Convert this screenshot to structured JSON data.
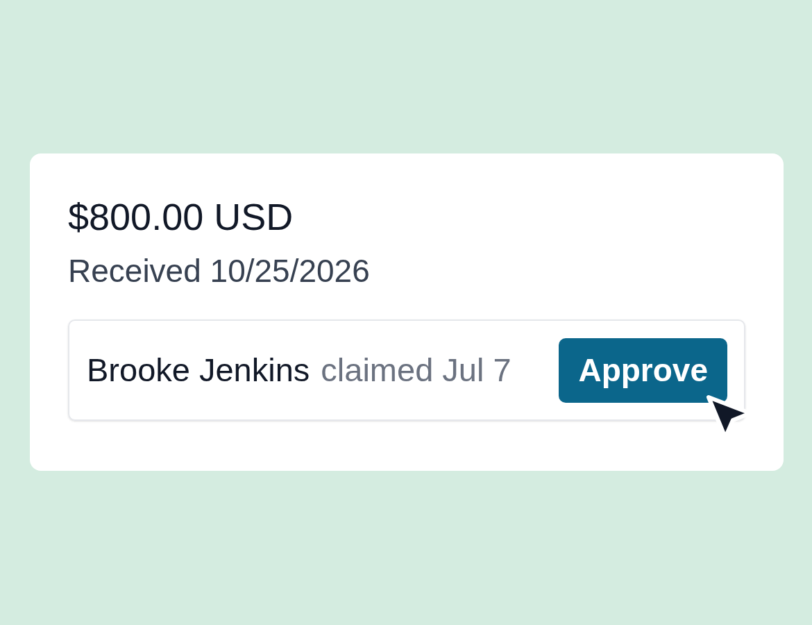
{
  "amount": "$800.00 USD",
  "received": "Received 10/25/2026",
  "claim": {
    "name": "Brooke Jenkins",
    "claimed": "claimed Jul 7",
    "action": "Approve"
  }
}
